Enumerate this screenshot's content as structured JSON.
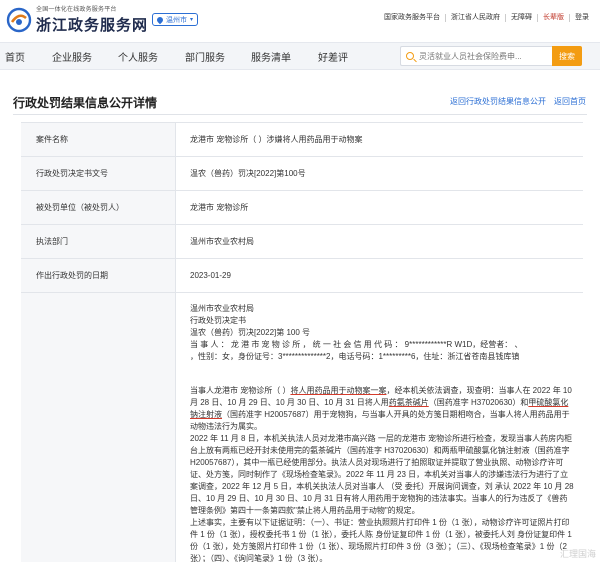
{
  "header": {
    "logo_subtitle": "全国一体化在线政务服务平台",
    "logo_title": "浙江政务服务网",
    "city": "温州市",
    "top_links": [
      "国家政务服务平台",
      "浙江省人民政府",
      "无障碍",
      "长辈版",
      "登录"
    ]
  },
  "nav": {
    "items": [
      "首页",
      "企业服务",
      "个人服务",
      "部门服务",
      "服务清单",
      "好差评"
    ]
  },
  "search": {
    "placeholder": "灵活就业人员社会保险费申...",
    "button": "搜索"
  },
  "detail": {
    "title": "行政处罚结果信息公开详情",
    "back_list": "返回行政处罚结果信息公开",
    "back_home": "返回首页"
  },
  "rows": [
    {
      "label": "案件名称",
      "value": "龙港市      宠物诊所（      ）涉嫌将人用药品用于动物案"
    },
    {
      "label": "行政处罚决定书文号",
      "value": "温农（兽药）罚决[2022]第100号"
    },
    {
      "label": "被处罚单位（被处罚人）",
      "value": "龙港市      宠物诊所"
    },
    {
      "label": "执法部门",
      "value": "温州市农业农村局"
    },
    {
      "label": "作出行政处罚的日期",
      "value": "2023-01-29"
    },
    {
      "label": "",
      "value": ""
    }
  ],
  "decision": {
    "lines": [
      "温州市农业农村局",
      "行政处罚决定书",
      "温农（兽药）罚决[2022]第 100 号",
      "当 事 人 ： 龙 港 市        宠 物 诊 所 ， 统 一 社 会 信 用 代 码 ： 9************R W1D，经营者：   、",
      "        ，性别：女，身份证号：3**************2，电话号码：1*********6，住址：浙江省苍南县钱库镇"
    ],
    "para1_pre": "当事人龙港市     宠物诊所（     ）",
    "para1_u1": "将人用药品用于动物案一案",
    "para1_mid": "，经本机关依法调查，现查明：当事人在 2022 年 10 月 28 日、10 月 29 日、10 月 30 日、10 月 31 日将人用",
    "para1_u2": "药氨茶碱片",
    "para1_mid2": "（国药准字 H37020630）和",
    "para1_u3": "甲硫酸氯化钠注射液",
    "para1_post": "（国药准字 H20057687）用于宠物狗，与当事人开具的处方笺日期相吻合，当事人将人用药品用于动物违法行为属实。",
    "para2": "2022 年 11 月 8 日，本机关执法人员对龙港市高兴路          一层的龙港市      宠物诊所进行检查，发现当事人药房内柜台上放有两瓶已经开封未使用完的氨茶碱片（国药准字 H37020630）和两瓶甲硫酸氯化钠注射液（国药准字H20057687），其中一瓶已经使用部分。执法人员对现场进行了拍照取证并提取了营业执照、动物诊疗许可证、处方笺，同时制作了《现场检查笔录》。2022 年 11 月 23 日，本机关对当事人的涉嫌违法行为进行了立案调查，2022 年 12 月 5 日，本机关执法人员对当事人        （受    委托）开展询问调查，刘     承认 2022 年 10 月 28 日、10 月 29 日、10 月 30 日、10 月 31 日有将人用药用于宠物狗的违法事实。当事人的行为违反了《兽药管理条例》第四十一条第四款\"禁止将人用药品用于动物\"的规定。",
    "para3": "上述事实，主要有以下证据证明：（一）、书证：营业执照照片打印件 1 份（1 张），动物诊疗许可证照片打印件 1 份（1 张），授权委托书 1 份（1 张），委托人陈     身份证复印件 1 份（1 张），被委托人刘     身份证复印件 1 份（1 张），处方笺照片打印件 1 份（1 张）、现场照片打印件 3 份（3 张）；（三）、《现场检查笔录》1 份（2 张）；（四）、《询问笔录》1 份（3 张）。"
  },
  "watermark": "汇理国海"
}
